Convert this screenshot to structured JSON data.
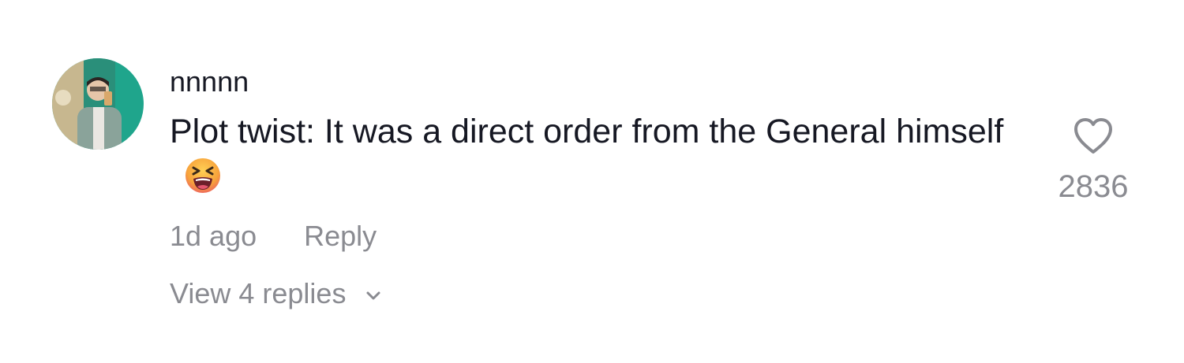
{
  "comment": {
    "username": "nnnnn",
    "text": "Plot twist: It was a direct order from the General himself",
    "emoji_icon": "tired-face-emoji",
    "time": "1d ago",
    "reply_label": "Reply",
    "view_replies_label": "View 4 replies",
    "likes": "2836",
    "like_icon": "heart-outline-icon",
    "expand_icon": "chevron-down-icon"
  },
  "colors": {
    "primary_text": "#161823",
    "secondary_text": "#8a8b91",
    "background": "#ffffff",
    "avatar_backdrop": "#1fa58c"
  }
}
